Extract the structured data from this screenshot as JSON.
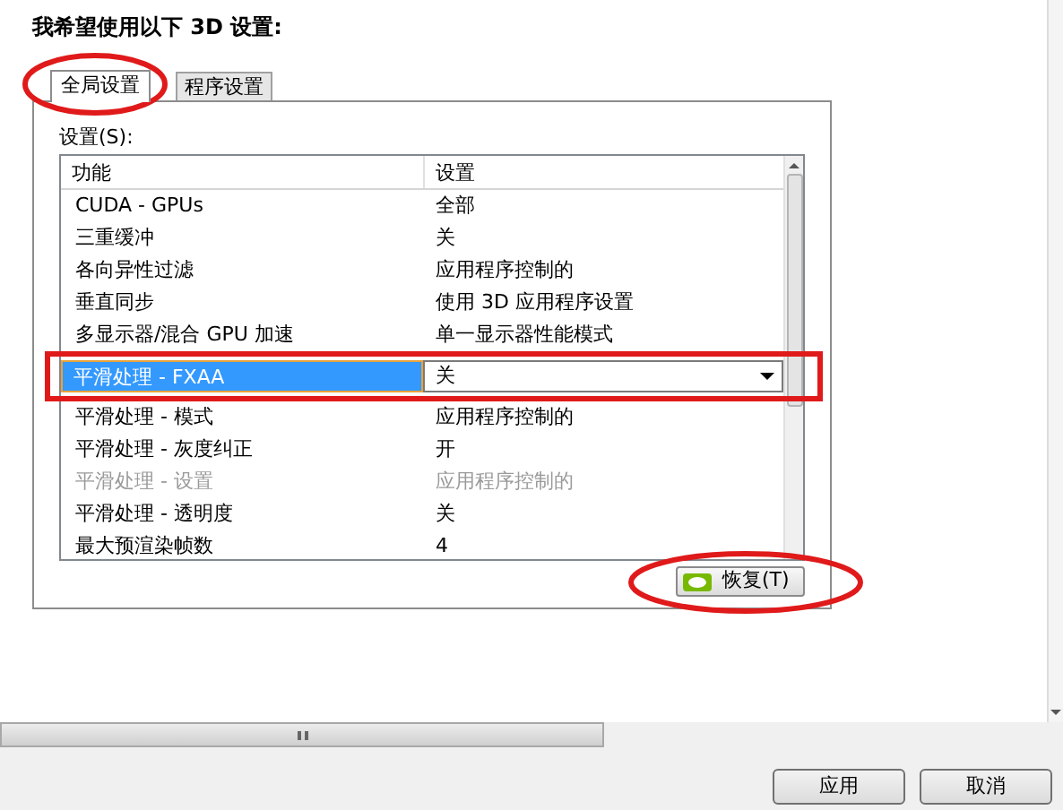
{
  "heading": "我希望使用以下 3D 设置:",
  "tabs": [
    {
      "label": "全局设置",
      "selected": true
    },
    {
      "label": "程序设置",
      "selected": false
    }
  ],
  "settings_label": "设置(S):",
  "table": {
    "columns": [
      "功能",
      "设置"
    ],
    "rows": [
      {
        "feature": "CUDA - GPUs",
        "value": "全部",
        "selected": false,
        "disabled": false
      },
      {
        "feature": "三重缓冲",
        "value": "关",
        "selected": false,
        "disabled": false
      },
      {
        "feature": "各向异性过滤",
        "value": "应用程序控制的",
        "selected": false,
        "disabled": false
      },
      {
        "feature": "垂直同步",
        "value": "使用 3D 应用程序设置",
        "selected": false,
        "disabled": false
      },
      {
        "feature": "多显示器/混合 GPU 加速",
        "value": "单一显示器性能模式",
        "selected": false,
        "disabled": false
      },
      {
        "feature": "平滑处理 - FXAA",
        "value": "关",
        "selected": true,
        "disabled": false
      },
      {
        "feature": "平滑处理 - 模式",
        "value": "应用程序控制的",
        "selected": false,
        "disabled": false
      },
      {
        "feature": "平滑处理 - 灰度纠正",
        "value": "开",
        "selected": false,
        "disabled": false
      },
      {
        "feature": "平滑处理 - 设置",
        "value": "应用程序控制的",
        "selected": false,
        "disabled": true
      },
      {
        "feature": "平滑处理 - 透明度",
        "value": "关",
        "selected": false,
        "disabled": false
      },
      {
        "feature": "最大预渲染帧数",
        "value": "4",
        "selected": false,
        "disabled": false
      }
    ]
  },
  "restore_button": "恢复(T)",
  "buttons": [
    "应用",
    "取消"
  ]
}
